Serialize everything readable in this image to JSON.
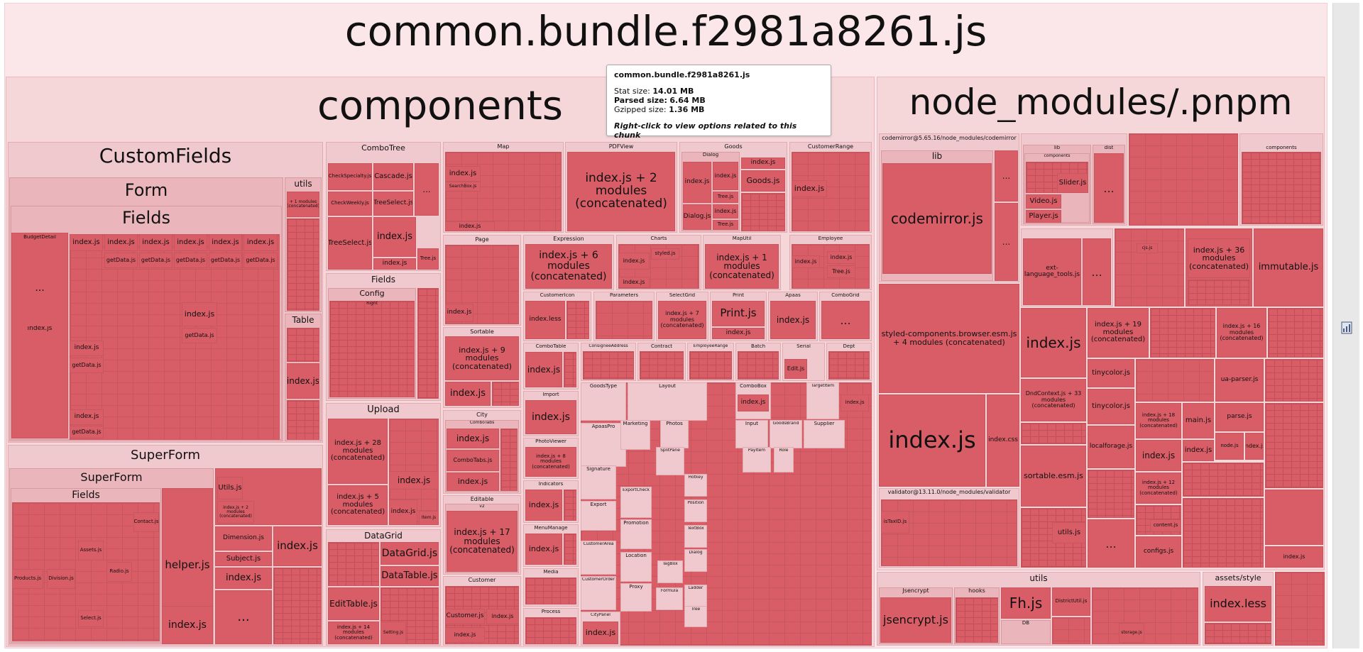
{
  "sidebar_toggle": ">",
  "bundle": {
    "title": "common.bundle.f2981a8261.js"
  },
  "components": {
    "title": "components",
    "customfields": "CustomFields",
    "form": "Form",
    "fields": "Fields",
    "budgetdetail": "BudgetDetail",
    "utils": "utils",
    "table": "Table",
    "superform": "SuperForm",
    "superform_inner": "SuperForm",
    "superform_fields": "Fields",
    "helper": "helper.js",
    "utils_js": "Utils.js",
    "index2mod": "index.js + 2 modules (concatenated)",
    "dimension": "Dimension.js",
    "subject": "Subject.js",
    "combotree": "ComboTree",
    "cascade": "Cascade.js",
    "treeselect": "TreeSelect.js",
    "checkspecialty": "CheckSpecialty.js",
    "checkweekly": "CheckWeekly.js",
    "fields2": "Fields",
    "config": "Config",
    "right": "Right",
    "upload": "Upload",
    "upload_28": "index.js + 28 modules (concatenated)",
    "upload_5": "index.js + 5 modules (concatenated)",
    "datagrid": "DataGrid",
    "datagrid_js": "DataGrid.js",
    "datatable_js": "DataTable.js",
    "edittable_js": "EditTable.js",
    "datagrid_14": "index.js + 14 modules (concatenated)",
    "setting": "Setting.js",
    "map": "Map",
    "searchbox": "SearchBox.js",
    "pdfview": "PDFView",
    "pdfview_2": "index.js + 2 modules (concatenated)",
    "goods": "Goods",
    "dialog": "Dialog",
    "goods_js": "Goods.js",
    "dialog_js": "Dialog.js",
    "tree_js": "Tree.js",
    "customerrange": "CustomerRange",
    "page": "Page",
    "expression": "Expression",
    "expression_6": "index.js + 6 modules (concatenated)",
    "charts": "Charts",
    "styled": "styled.js",
    "maputil": "MapUtil",
    "maputil_1": "index.js + 1 modules (concatenated)",
    "employee": "Employee",
    "sortable": "Sortable",
    "sortable_9": "index.js + 9 modules (concatenated)",
    "customicon": "CustomerIcon",
    "index_less": "index.less",
    "parameters": "Parameters",
    "selectgrid": "SelectGrid",
    "selectgrid_7": "index.js + 7 modules (concatenated)",
    "print": "Print",
    "print_js": "Print.js",
    "apaas": "Apaas",
    "combogrid": "ComboGrid",
    "city": "City",
    "combotabs": "ComboTabs",
    "combotabs_js": "ComboTabs.js",
    "combotable": "ComboTable",
    "import": "Import",
    "photoviewer": "PhotoViewer",
    "photoviewer_8": "index.js + 8 modules (concatenated)",
    "indicators": "Indicators",
    "menumanage": "MenuManage",
    "media": "Media",
    "process": "Process",
    "editable": "Editable",
    "v2": "v2",
    "editable_17": "index.js + 17 modules (concatenated)",
    "customer": "Customer",
    "customer_js": "Customer.js",
    "consignee": "ConsigneeAddress",
    "contract": "Contract",
    "employeerange": "EmployeeRange",
    "batch": "Batch",
    "serial": "Serial",
    "edit": "Edit.js",
    "dept": "Dept",
    "goodstype": "GoodsType",
    "layout": "Layout",
    "combobox": "ComboBox",
    "targetitem": "TargetItem",
    "apaaspro": "ApaasPro",
    "marketing": "Marketing",
    "photos": "Photos",
    "input": "Input",
    "goodsbrand": "GoodsBrand",
    "supplier": "Supplier",
    "signature": "Signature",
    "splitpane": "SplitPane",
    "payitem": "PayItem",
    "role": "Role",
    "exportcheck": "ExportCheck",
    "hotkey": "Hotkey",
    "position": "Position",
    "export": "Export",
    "promotion": "Promotion",
    "textbox": "TextBox",
    "customerarea": "CustomerArea",
    "location": "Location",
    "dialog2": "Dialog",
    "customerorder": "CustomerOrder",
    "tagbox": "TagBox",
    "proxy": "Proxy",
    "ladder": "Ladder",
    "formula": "Formula",
    "tree": "Tree",
    "citypanel": "CityPanel",
    "index": "index.js",
    "getdata": "getData.js",
    "contact": "Contact.js",
    "assets": "Assets.js",
    "radio": "Radio.js",
    "products": "Products.js",
    "division": "Division.js",
    "select": "Select.js",
    "item": "Item.js",
    "dots": "...",
    "more": "+ 1 modules (concatenated)",
    "superform_more": "superForm.js"
  },
  "node_modules": {
    "title": "node_modules/.pnpm",
    "codemirror_pkg": "codemirror@5.65.16/node_modules/codemirror",
    "lib": "lib",
    "codemirror_js": "codemirror.js",
    "styled_components": "styled-components.browser.esm.js + 4 modules (concatenated)",
    "index_js": "index.js",
    "index_css": "index.css",
    "validator": "validator@13.11.0/node_modules/validator",
    "istaxid": "isTaxID.js",
    "lib2": "lib",
    "dist": "dist",
    "components": "components",
    "slider": "Slider.js",
    "video": "Video.js",
    "player": "Player.js",
    "ext_language": "ext-language_tools.js",
    "index_36": "index.js + 36 modules (concatenated)",
    "immutable": "immutable.js",
    "index_19": "index.js + 19 modules (concatenated)",
    "index_16": "index.js + 16 modules (concatenated)",
    "tinycolor": "tinycolor.js",
    "tinycolor2": "tinycolor.js",
    "uaparser": "ua-parser.js",
    "dndcontext": "DndContext.js + 33 modules (concatenated)",
    "index_18": "index.js + 18 modules (concatenated)",
    "main": "main.js",
    "parse": "parse.js",
    "localforage": "localforage.js",
    "sortable_esm": "sortable.esm.js",
    "index_12": "index.js + 12 modules (concatenated)",
    "utils_js": "utils.js",
    "configs": "configs.js",
    "content": "content.js",
    "node": "node.js",
    "cjs": "cjs.js"
  },
  "utils": {
    "title": "utils",
    "jsencrypt": "Jsencrypt",
    "jsencrypt_js": "jsencrypt.js",
    "hooks": "hooks",
    "fh": "Fh.js",
    "db": "DB",
    "districtutil": "DistrictUtil.js",
    "storage": "storage.js"
  },
  "assets": {
    "title": "assets/style",
    "index_less": "index.less"
  },
  "tooltip": {
    "title": "common.bundle.f2981a8261.js",
    "stat_label": "Stat size:",
    "stat_value": "14.01 MB",
    "parsed_label": "Parsed size:",
    "parsed_value": "6.64 MB",
    "gzip_label": "Gzipped size:",
    "gzip_value": "1.36 MB",
    "hint": "Right-click to view options related to this chunk"
  },
  "colors": {
    "leaf": "#d95d67",
    "group": "#f5d6d9",
    "background": "#fbe7e9"
  }
}
